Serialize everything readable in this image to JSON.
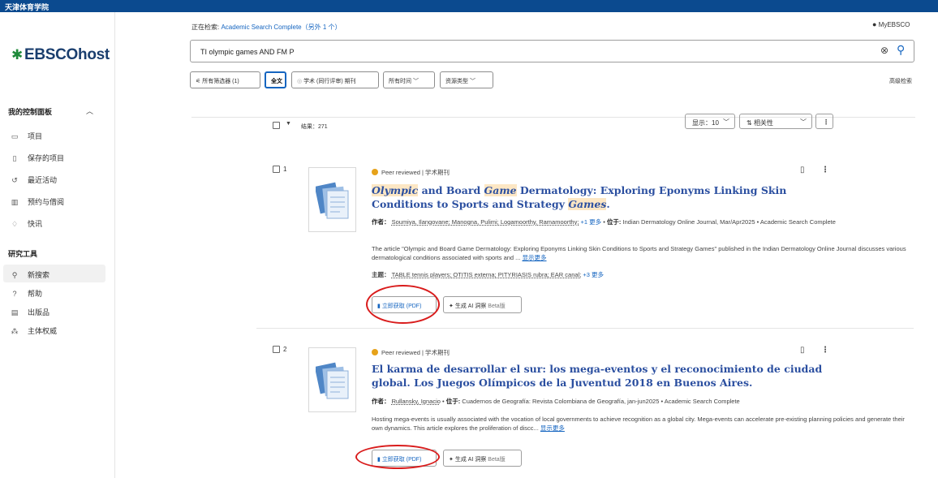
{
  "topbar": {
    "institution": "天津体育学院"
  },
  "sidebar": {
    "logo": "EBSCOhost",
    "dashboard_heading": "我的控制面板",
    "dashboard_items": [
      {
        "label": "项目",
        "icon": "folder-icon"
      },
      {
        "label": "保存的项目",
        "icon": "bookmark-icon"
      },
      {
        "label": "最近活动",
        "icon": "history-icon"
      },
      {
        "label": "预约与借阅",
        "icon": "books-icon"
      },
      {
        "label": "快讯",
        "icon": "bell-icon"
      }
    ],
    "tools_heading": "研究工具",
    "tools_items": [
      {
        "label": "新搜索",
        "icon": "search-icon"
      },
      {
        "label": "帮助",
        "icon": "help-icon"
      },
      {
        "label": "出版品",
        "icon": "publications-icon"
      },
      {
        "label": "主体权威",
        "icon": "subject-tree-icon"
      }
    ]
  },
  "header": {
    "searching_prefix": "正在检索: ",
    "searching_db": "Academic Search Complete（另外 1 个）",
    "account": "MyEBSCO"
  },
  "search": {
    "query": "TI olympic games AND FM P",
    "advanced": "高级检索"
  },
  "filters": {
    "all_filters": "所有筛选器 (1)",
    "fulltext": "全文",
    "peer_reviewed": "学术 (同行评审) 期刊",
    "all_time": "所有时间",
    "source_type": "资源类型"
  },
  "results_bar": {
    "count": "结果：271",
    "show": "显示：10",
    "sort": "相关性"
  },
  "results": [
    {
      "number": "1",
      "meta": "Peer reviewed | 学术期刊",
      "title_parts": [
        "Olympic",
        " and Board ",
        "Game",
        " Dermatology: Exploring Eponyms Linking Skin Conditions to Sports and Strategy ",
        "Games",
        "."
      ],
      "authors_label": "作者：",
      "authors": "Soumiya, Ilangovane; Manogna, Pulimi; Logamoorthy, Ramamoorthy;",
      "authors_more": "+1 更多",
      "source_label": "位于:",
      "source": "Indian Dermatology Online Journal, Mar/Apr2025 • Academic Search Complete",
      "abstract": "The article \"Olympic and Board Game Dermatology: Exploring Eponyms Linking Skin Conditions to Sports and Strategy Games\" published in the Indian Dermatology Online Journal discusses various dermatological conditions associated with sports and ...",
      "show_more": "显示更多",
      "subjects_label": "主题：",
      "subjects": "TABLE tennis players; OTITIS externa; PITYRIASIS rubra; EAR canal;",
      "subjects_more": "+3 更多",
      "pdf_button": "立即获取 (PDF)",
      "ai_button": "生成 AI 洞察",
      "beta": "Beta版"
    },
    {
      "number": "2",
      "meta": "Peer reviewed | 学术期刊",
      "title": "El karma de desarrollar el sur: los mega-eventos y el reconocimiento de ciudad global. Los Juegos Olímpicos de la Juventud 2018 en Buenos Aires.",
      "authors_label": "作者：",
      "authors": "Rullansky, Ignacio",
      "source_label": "位于:",
      "source": "Cuadernos de Geografía: Revista Colombiana de Geografía, jan-jun2025 • Academic Search Complete",
      "abstract": "Hosting mega-events is usually associated with the vocation of local governments to achieve recognition as a global city. Mega-events can accelerate pre-existing planning policies and generate their own dynamics. This article explores the proliferation of discc...",
      "show_more": "显示更多",
      "pdf_button": "立即获取 (PDF)",
      "ai_button": "生成 AI 洞察",
      "beta": "Beta版"
    }
  ],
  "colors": {
    "brand": "#0b4a8f",
    "link": "#1565c0",
    "title": "#2b4fa0",
    "highlight": "#fde7c4",
    "annotation": "#d91c1c",
    "badge": "#e6a21a"
  }
}
